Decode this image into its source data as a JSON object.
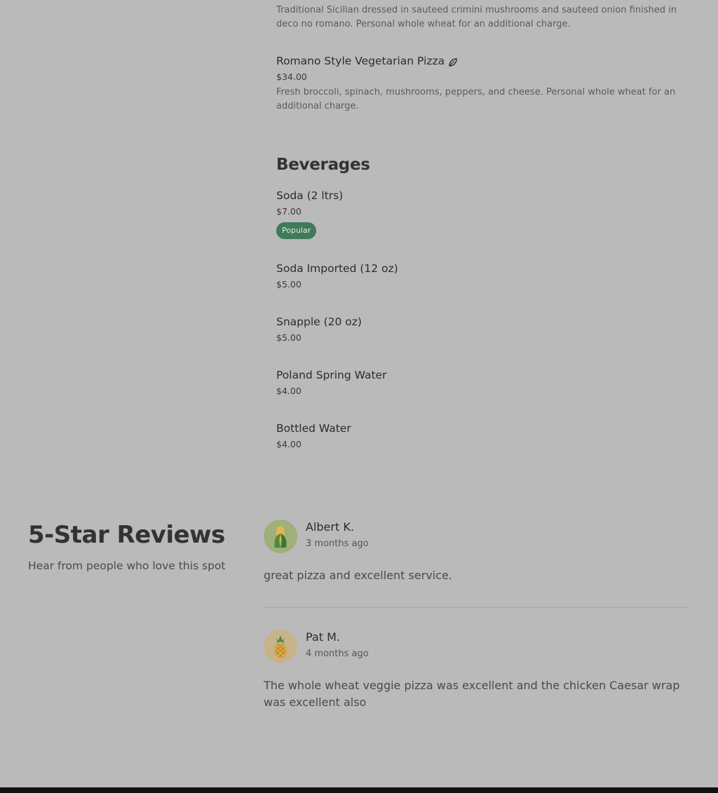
{
  "menu": {
    "pizza_section": {
      "items": [
        {
          "description": "Traditional Sicilian dressed in sauteed crimini mushrooms and sauteed onion finished in deco no romano. Personal whole wheat for an additional charge."
        },
        {
          "name": "Romano Style Vegetarian Pizza",
          "icon": "leaf-icon",
          "price": "$34.00",
          "description": "Fresh broccoli, spinach, mushrooms, peppers, and cheese. Personal whole wheat for an additional charge."
        }
      ]
    },
    "beverages": {
      "title": "Beverages",
      "items": [
        {
          "name": "Soda (2 ltrs)",
          "price": "$7.00",
          "badge": "Popular"
        },
        {
          "name": "Soda Imported (12 oz)",
          "price": "$5.00"
        },
        {
          "name": "Snapple (20 oz)",
          "price": "$5.00"
        },
        {
          "name": "Poland Spring Water",
          "price": "$4.00"
        },
        {
          "name": "Bottled Water",
          "price": "$4.00"
        }
      ]
    }
  },
  "reviews": {
    "title": "5-Star Reviews",
    "subtitle": "Hear from people who love this spot",
    "items": [
      {
        "avatar": "corn-icon",
        "name": "Albert K.",
        "date": "3 months ago",
        "text": "great pizza and excellent service."
      },
      {
        "avatar": "pineapple-icon",
        "name": "Pat M.",
        "date": "4 months ago",
        "text": "The whole wheat veggie pizza was excellent and the chicken Caesar wrap was excellent also"
      }
    ]
  },
  "colors": {
    "background": "#bababa",
    "badge": "#3f7a5a",
    "footer": "#121212"
  }
}
